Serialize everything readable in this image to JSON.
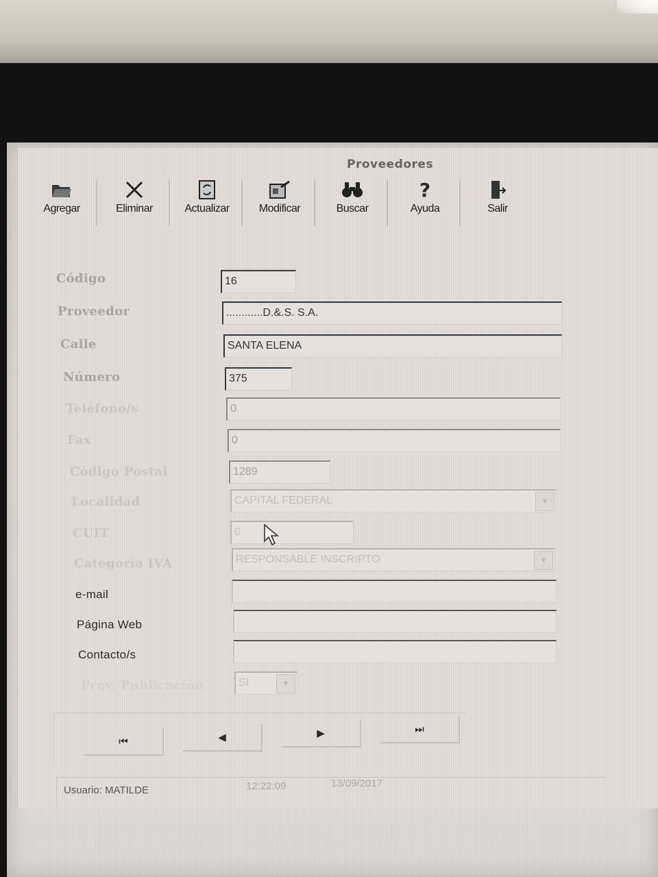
{
  "window": {
    "title": "Proveedores"
  },
  "toolbar": {
    "buttons": [
      {
        "id": "agregar",
        "label": "Agregar",
        "icon": "folder-open-icon"
      },
      {
        "id": "eliminar",
        "label": "Eliminar",
        "icon": "close-x-icon"
      },
      {
        "id": "actualizar",
        "label": "Actualizar",
        "icon": "refresh-icon"
      },
      {
        "id": "modificar",
        "label": "Modificar",
        "icon": "edit-icon"
      },
      {
        "id": "buscar",
        "label": "Buscar",
        "icon": "binoculars-icon"
      },
      {
        "id": "ayuda",
        "label": "Ayuda",
        "icon": "help-icon"
      },
      {
        "id": "salir",
        "label": "Salir",
        "icon": "exit-door-icon"
      }
    ]
  },
  "form": {
    "codigo": {
      "label": "Código",
      "value": "16"
    },
    "proveedor": {
      "label": "Proveedor",
      "value": "............D.&.S. S.A."
    },
    "calle": {
      "label": "Calle",
      "value": "SANTA ELENA"
    },
    "numero": {
      "label": "Número",
      "value": "375"
    },
    "telefono": {
      "label": "Teléfono/s",
      "value": "0"
    },
    "fax": {
      "label": "Fax",
      "value": "0"
    },
    "codigo_postal": {
      "label": "Código Postal",
      "value": "1289"
    },
    "localidad": {
      "label": "Localidad",
      "value": "CAPITAL FEDERAL"
    },
    "cuit": {
      "label": "CUIT",
      "value": "0"
    },
    "categoria_iva": {
      "label": "Categoría IVA",
      "value": "RESPONSABLE INSCRIPTO"
    },
    "email": {
      "label": "e-mail",
      "value": ""
    },
    "pagina_web": {
      "label": "Página Web",
      "value": ""
    },
    "contactos": {
      "label": "Contacto/s",
      "value": ""
    },
    "publicacion": {
      "label": "Prov. Publicación",
      "value": "SI"
    }
  },
  "navigation": {
    "first": "⏮",
    "prev": "◀",
    "next": "▶",
    "last": "⏭"
  },
  "status": {
    "usuario": "Usuario: MATILDE",
    "hora": "12:22:09",
    "fecha": "13/09/2017"
  },
  "colors": {
    "screen_bg": "#e2ddd9",
    "text_dark": "#2b2b2b",
    "label_faded": "#aaa49f"
  }
}
